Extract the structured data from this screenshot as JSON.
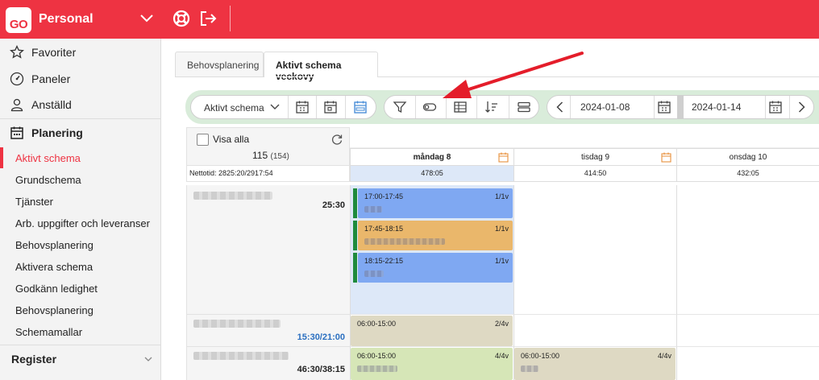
{
  "app": {
    "logo_text": "GO",
    "title": "Personal"
  },
  "sidebar": {
    "items": [
      {
        "label": "Favoriter",
        "icon": "star-icon"
      },
      {
        "label": "Paneler",
        "icon": "gauge-icon"
      },
      {
        "label": "Anställd",
        "icon": "person-icon"
      },
      {
        "label": "Planering",
        "icon": "calendar-icon"
      }
    ],
    "planering_sub": [
      "Aktivt schema",
      "Grundschema",
      "Tjänster",
      "Arb. uppgifter och leveranser",
      "Behovsplanering",
      "Aktivera schema",
      "Godkänn ledighet",
      "Behovsplanering",
      "Schemamallar"
    ],
    "register": "Register"
  },
  "tabs": [
    {
      "label": "Behovsplanering",
      "active": false
    },
    {
      "label": "Aktivt schema veckovy",
      "active": true
    }
  ],
  "toolbar": {
    "view_select": "Aktivt schema",
    "date_from": "2024-01-08",
    "date_to": "2024-01-14",
    "accent_color": "#d9ecda"
  },
  "grid": {
    "visa_alla": "Visa alla",
    "count": "115",
    "count_total": "(154)",
    "netto": "Nettotid: 2825:20/2917:54",
    "days": [
      {
        "label": "måndag 8",
        "sum": "478:05",
        "bold": true
      },
      {
        "label": "tisdag 9",
        "sum": "414:50",
        "bold": false
      },
      {
        "label": "onsdag 10",
        "sum": "432:05",
        "bold": false
      }
    ],
    "employees": [
      {
        "hours": "25:30"
      },
      {
        "hours": "15:30/21:00"
      },
      {
        "hours": "46:30/38:15"
      }
    ],
    "shifts": [
      {
        "time": "17:00-17:45",
        "ratio": "1/1v",
        "color": "#7fa8f2"
      },
      {
        "time": "17:45-18:15",
        "ratio": "1/1v",
        "color": "#eab76b"
      },
      {
        "time": "18:15-22:15",
        "ratio": "1/1v",
        "color": "#7fa8f2"
      },
      {
        "time": "06:00-15:00",
        "ratio": "2/4v",
        "color": "#ded9c3"
      },
      {
        "time": "06:00-15:00",
        "ratio": "4/4v",
        "color": "#d6e6b7"
      },
      {
        "time": "06:00-15:00",
        "ratio": "4/4v",
        "color": "#ded9c3"
      }
    ]
  }
}
